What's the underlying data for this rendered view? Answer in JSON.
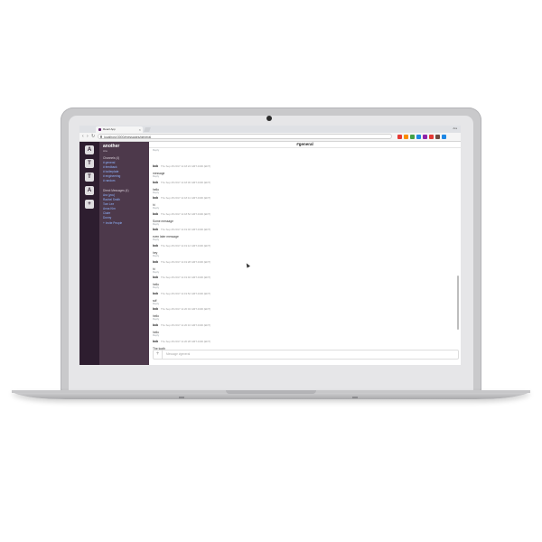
{
  "browser": {
    "tab_title": "React App",
    "tab_close": "×",
    "url": "localhost:3000/messages/general",
    "window_user": "Ara",
    "nav": {
      "back": "‹",
      "forward": "›",
      "reload": "↻"
    },
    "extension_colors": [
      "#e53935",
      "#fb8c00",
      "#43a047",
      "#1e88e5",
      "#8e24aa",
      "#e53935",
      "#6d4c41",
      "#1e88e5"
    ]
  },
  "teams": [
    "A",
    "T",
    "T",
    "A",
    "+"
  ],
  "sidebar": {
    "workspace": "another",
    "user": "Ara",
    "channels_header": "Channels (4)",
    "channels": [
      "# general",
      "# feedback",
      "# boilerplate",
      "# engineering",
      "# random"
    ],
    "dm_header": "Direct Messages (4)",
    "dms": [
      "Ara (you)",
      "Rachel Smith",
      "Tom Lee",
      "Anna Kim",
      "Claire",
      "Donny"
    ],
    "invite": "+ Invite People"
  },
  "main": {
    "channel_title": "#general",
    "messages": [
      {
        "author": "",
        "time": "",
        "text": "",
        "reply": "Reply"
      },
      {
        "author": "bob",
        "time": "Thu Sep 28 2017 11:18:24 GMT-0400 (EDT)",
        "text": "message",
        "reply": "Reply"
      },
      {
        "author": "bob",
        "time": "Thu Sep 28 2017 11:18:30 GMT-0400 (EDT)",
        "text": "hello",
        "reply": "Reply"
      },
      {
        "author": "bob",
        "time": "Thu Sep 28 2017 11:18:41 GMT-0400 (EDT)",
        "text": "hi",
        "reply": "Reply"
      },
      {
        "author": "bob",
        "time": "Thu Sep 28 2017 11:18:52 GMT-0400 (EDT)",
        "text": "Some message",
        "reply": "Reply"
      },
      {
        "author": "bob",
        "time": "Thu Sep 28 2017 11:19:02 GMT-0400 (EDT)",
        "text": "even later message",
        "reply": "Reply"
      },
      {
        "author": "bob",
        "time": "Thu Sep 28 2017 11:19:12 GMT-0400 (EDT)",
        "text": "hey",
        "reply": "Reply"
      },
      {
        "author": "bob",
        "time": "Thu Sep 28 2017 11:19:28 GMT-0400 (EDT)",
        "text": "hi",
        "reply": "Reply"
      },
      {
        "author": "bob",
        "time": "Thu Sep 28 2017 11:19:40 GMT-0400 (EDT)",
        "text": "hello",
        "reply": "Reply"
      },
      {
        "author": "bob",
        "time": "Thu Sep 28 2017 11:19:52 GMT-0400 (EDT)",
        "text": "sdf",
        "reply": "Reply"
      },
      {
        "author": "bob",
        "time": "Thu Sep 28 2017 11:20:04 GMT-0400 (EDT)",
        "text": "hello",
        "reply": "Reply"
      },
      {
        "author": "bob",
        "time": "Thu Sep 28 2017 11:20:16 GMT-0400 (EDT)",
        "text": "hello",
        "reply": "Reply"
      },
      {
        "author": "bob",
        "time": "Thu Sep 28 2017 11:20:28 GMT-0400 (EDT)",
        "text": "The tooth",
        "reply": "Reply"
      }
    ],
    "composer_plus": "+",
    "composer_placeholder": "Message #general"
  },
  "colors": {
    "team_bar": "#2d1d2f",
    "sidebar": "#4d394b",
    "channel_link": "#8fb4ff"
  }
}
